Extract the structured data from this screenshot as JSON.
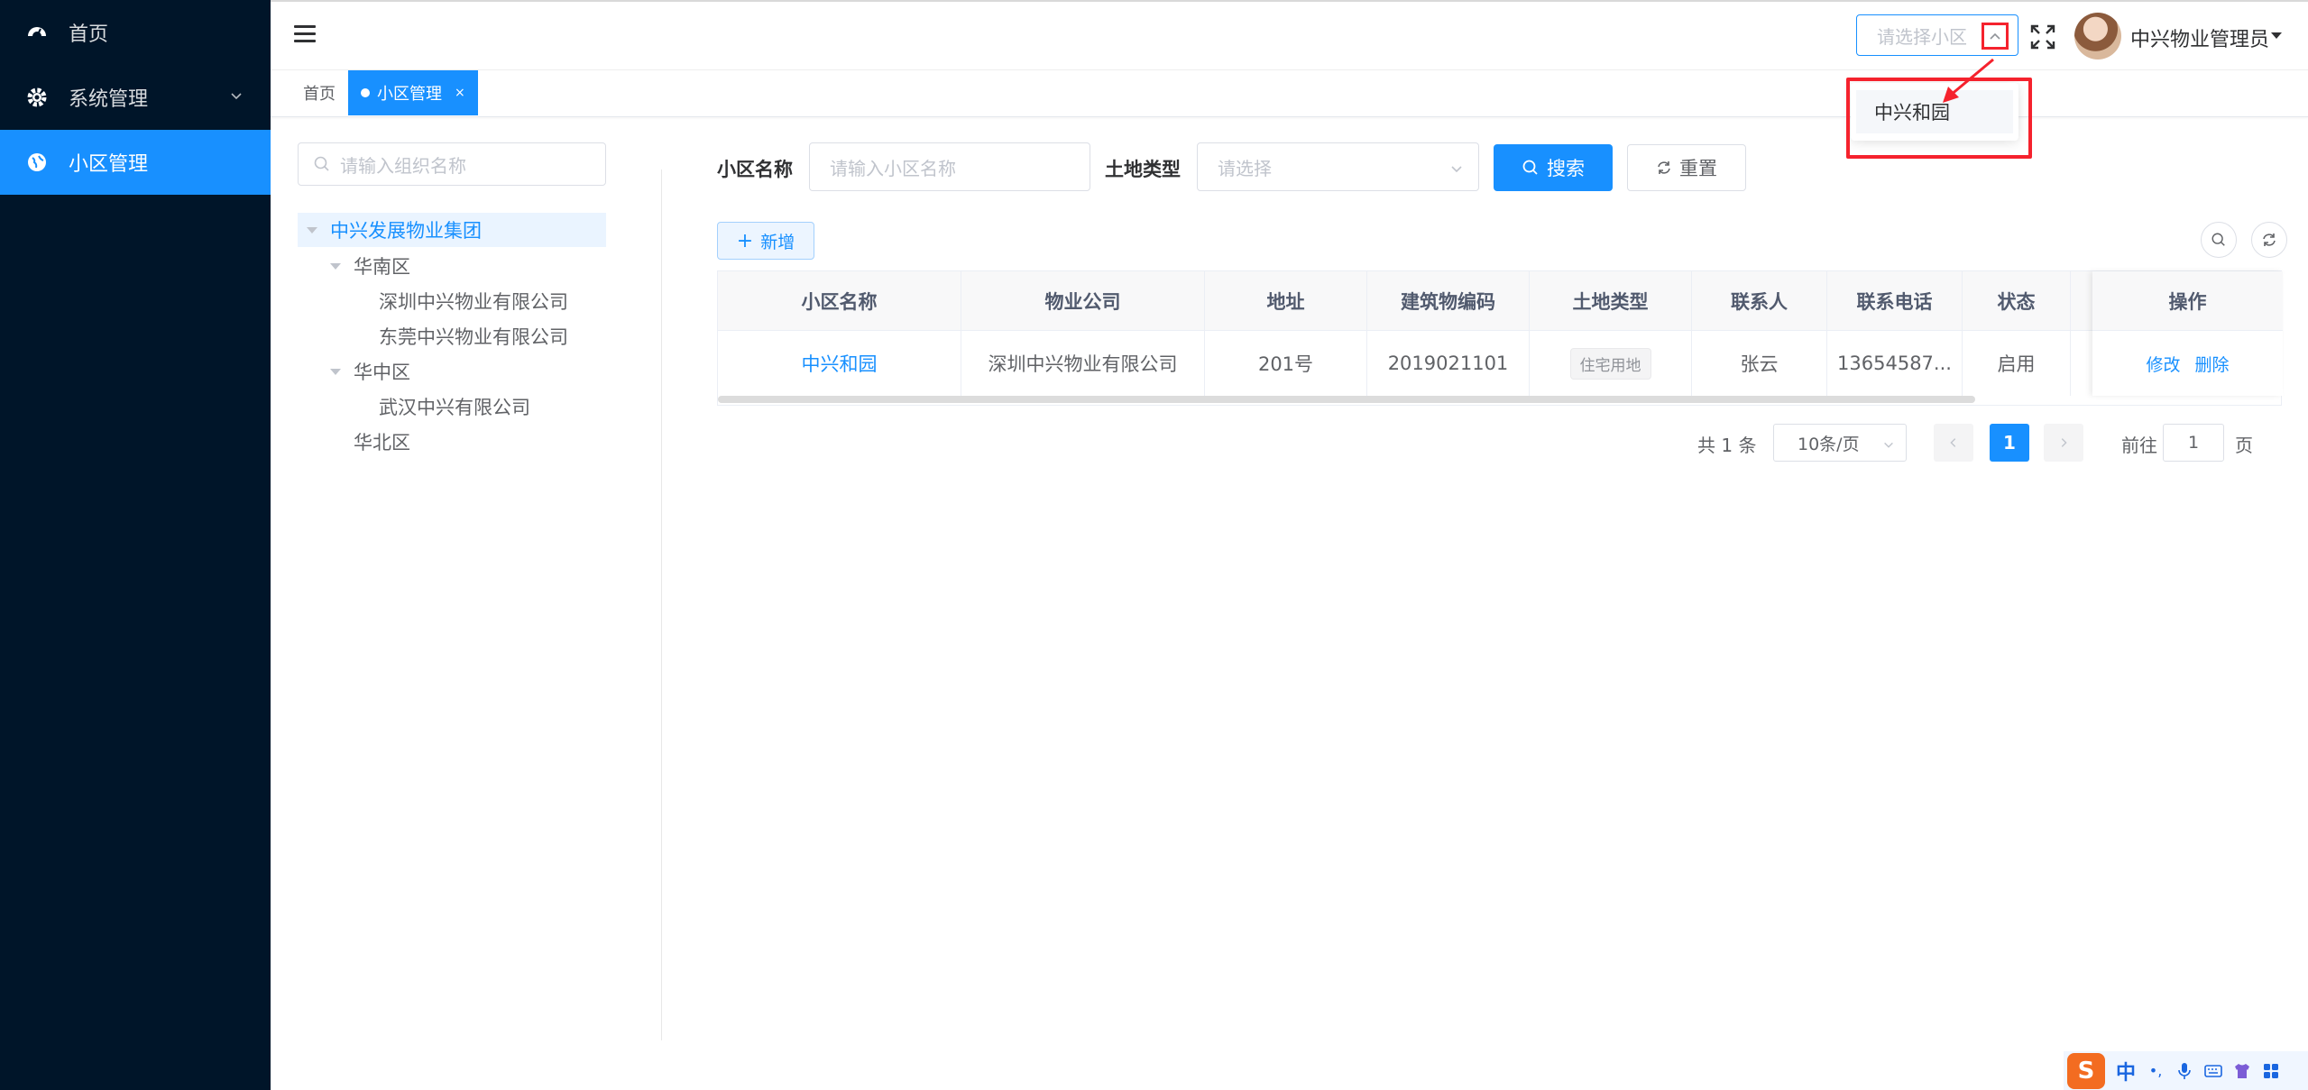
{
  "sidebar": {
    "items": [
      {
        "label": "首页",
        "icon": "dashboard-icon"
      },
      {
        "label": "系统管理",
        "icon": "gear-icon"
      },
      {
        "label": "小区管理",
        "icon": "globe-icon"
      }
    ]
  },
  "header": {
    "community_select_placeholder": "请选择小区",
    "user_name": "中兴物业管理员"
  },
  "tabs": {
    "home": "首页",
    "active": "小区管理",
    "close": "×"
  },
  "dropdown": {
    "options": [
      "中兴和园"
    ]
  },
  "tree": {
    "search_placeholder": "请输入组织名称",
    "nodes": [
      {
        "label": "中兴发展物业集团"
      },
      {
        "label": "华南区"
      },
      {
        "label": "深圳中兴物业有限公司"
      },
      {
        "label": "东莞中兴物业有限公司"
      },
      {
        "label": "华中区"
      },
      {
        "label": "武汉中兴有限公司"
      },
      {
        "label": "华北区"
      }
    ]
  },
  "search": {
    "name_label": "小区名称",
    "name_placeholder": "请输入小区名称",
    "land_label": "土地类型",
    "land_placeholder": "请选择",
    "search_btn": "搜索",
    "reset_btn": "重置",
    "add_btn": "新增"
  },
  "table": {
    "columns": [
      "小区名称",
      "物业公司",
      "地址",
      "建筑物编码",
      "土地类型",
      "联系人",
      "联系电话",
      "状态",
      "操作"
    ],
    "rows": [
      {
        "name": "中兴和园",
        "company": "深圳中兴物业有限公司",
        "address": "201号",
        "code": "2019021101",
        "land_type": "住宅用地",
        "contact": "张云",
        "phone": "13654587...",
        "status": "启用",
        "edit": "修改",
        "delete": "删除"
      }
    ]
  },
  "pagination": {
    "total": "共 1 条",
    "page_size": "10条/页",
    "current": "1",
    "goto_label": "前往",
    "goto_value": "1",
    "page_suffix": "页"
  },
  "ime": {
    "logo": "S",
    "mode": "中",
    "punct": "•,"
  },
  "colors": {
    "primary": "#1890ff",
    "sidebar_bg": "#001529",
    "highlight": "#f5222d"
  }
}
